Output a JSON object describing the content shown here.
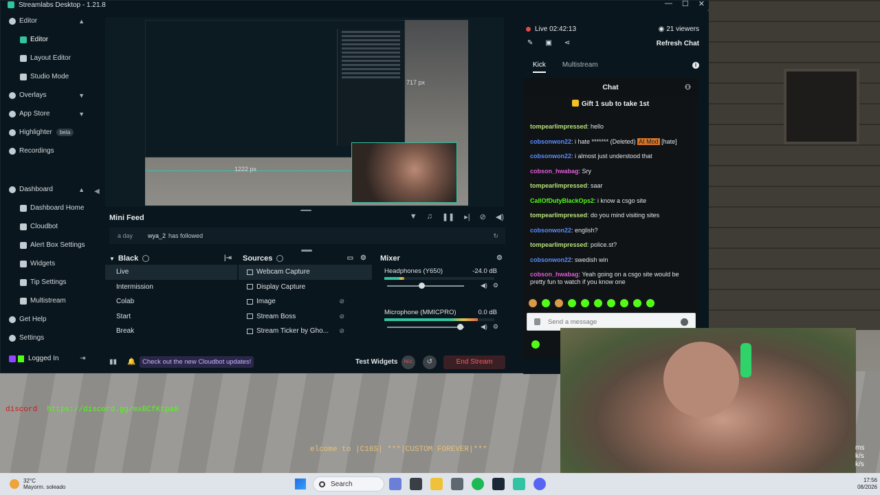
{
  "app": {
    "title": "Streamlabs Desktop - 1.21.8"
  },
  "sidebar": {
    "items": [
      {
        "label": "Editor",
        "icon": "editor-icon",
        "level": 0,
        "expanded": true
      },
      {
        "label": "Editor",
        "icon": "edit-icon",
        "level": 1,
        "active": true
      },
      {
        "label": "Layout Editor",
        "icon": "layout-icon",
        "level": 1
      },
      {
        "label": "Studio Mode",
        "icon": "studio-mode-icon",
        "level": 1
      },
      {
        "label": "Overlays",
        "icon": "overlays-icon",
        "level": 0
      },
      {
        "label": "App Store",
        "icon": "app-store-icon",
        "level": 0
      },
      {
        "label": "Highlighter",
        "icon": "highlighter-icon",
        "level": 0,
        "badge": "beta"
      },
      {
        "label": "Recordings",
        "icon": "recordings-icon",
        "level": 0
      },
      {
        "label": "Dashboard",
        "icon": "dashboard-icon",
        "level": 0,
        "expanded": true
      },
      {
        "label": "Dashboard Home",
        "level": 1
      },
      {
        "label": "Cloudbot",
        "level": 1
      },
      {
        "label": "Alert Box Settings",
        "level": 1
      },
      {
        "label": "Widgets",
        "level": 1
      },
      {
        "label": "Tip Settings",
        "level": 1
      },
      {
        "label": "Multistream",
        "level": 1
      },
      {
        "label": "Get Help",
        "icon": "help-icon",
        "level": 0
      },
      {
        "label": "Settings",
        "icon": "settings-icon",
        "level": 0
      }
    ],
    "logged_in": "Logged In"
  },
  "preview": {
    "width_label": "1222  px",
    "height_label": "717  px"
  },
  "minifeed": {
    "title": "Mini Feed",
    "event": {
      "time": "a day",
      "user": "wya_2",
      "action": "has followed"
    }
  },
  "scenes": {
    "title": "Black",
    "items": [
      "Live",
      "Intermission",
      "Colab",
      "Start",
      "Break"
    ],
    "active_index": 0
  },
  "sources": {
    "title": "Sources",
    "items": [
      "Webcam Capture",
      "Display Capture",
      "Image",
      "Stream Boss",
      "Stream Ticker by Gho..."
    ],
    "active_index": 0
  },
  "mixer": {
    "title": "Mixer",
    "channels": [
      {
        "name": "Headphones (Y650)",
        "db": "-24.0 dB",
        "meter_level": 0.18,
        "volume": 0.45
      },
      {
        "name": "Microphone (MMICPRO)",
        "db": "0.0 dB",
        "meter_level": 0.85,
        "volume": 0.95
      }
    ]
  },
  "footer": {
    "notice": "Check out the new Cloudbot updates!",
    "test_widgets": "Test Widgets",
    "rec": "REC",
    "end_stream": "End Stream"
  },
  "chat_pane": {
    "live": "Live 02:42:13",
    "viewers": "21 viewers",
    "refresh_chat": "Refresh Chat",
    "tabs": [
      "Kick",
      "Multistream"
    ],
    "header": "Chat",
    "gift_banner": "Gift 1 sub to take 1st",
    "messages": [
      {
        "user": "tompearlimpressed",
        "color": "#b7e07a",
        "text": "hello"
      },
      {
        "user": "cobsonwon22",
        "color": "#5b8cff",
        "text": "i hate ******* (Deleted)",
        "badge": "AI Mod",
        "suffix": "[hate]"
      },
      {
        "user": "cobsonwon22",
        "color": "#5b8cff",
        "text": "i almost just understood that"
      },
      {
        "user": "cobson_hwabag",
        "color": "#e05ad6",
        "text": "Sry"
      },
      {
        "user": "tompearlimpressed",
        "color": "#b7e07a",
        "text": "saar"
      },
      {
        "user": "CallOfDutyBlackOps2",
        "color": "#53fc18",
        "text": "i know a csgo site"
      },
      {
        "user": "tompearlimpressed",
        "color": "#b7e07a",
        "text": "do you mind visiting sites"
      },
      {
        "user": "cobsonwon22",
        "color": "#5b8cff",
        "text": "english?"
      },
      {
        "user": "tompearlimpressed",
        "color": "#b7e07a",
        "text": "police.st?"
      },
      {
        "user": "cobsonwon22",
        "color": "#5b8cff",
        "text": "swedish win"
      },
      {
        "user": "cobson_hwabag",
        "color": "#e05ad6",
        "text": "Yeah going on a csgo site would be pretty fun to watch if you know one"
      }
    ],
    "input_placeholder": "Send a message"
  },
  "overlay": {
    "discord_label": "discord",
    "discord_url": "https://discord.gg/mxBCfKtpa6",
    "marquee": "elcome to |C16S| ***|CUSTOM FOREVER|***",
    "side_stats": [
      "ms",
      "k/s",
      "k/s"
    ]
  },
  "taskbar": {
    "weather_temp": "32°C",
    "weather_desc": "Mayorm. soleado",
    "search": "Search",
    "time": "17:56",
    "date": "08/2026"
  }
}
